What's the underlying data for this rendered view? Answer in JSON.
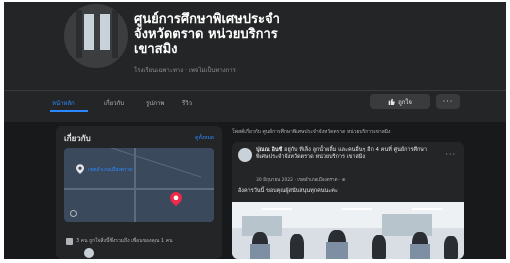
{
  "page": {
    "title_lines": [
      "ศูนย์การศึกษาพิเศษประจำ",
      "จังหวัดตราด หน่วยบริการ",
      "เขาสมิง"
    ],
    "subtitle": "โรงเรียนเฉพาะทาง · เพจไม่เป็นทางการ"
  },
  "tabs": [
    {
      "label": "หน้าหลัก",
      "active": true
    },
    {
      "label": "เกี่ยวกับ",
      "active": false
    },
    {
      "label": "รูปภาพ",
      "active": false
    },
    {
      "label": "รีวิว",
      "active": false
    }
  ],
  "actions": {
    "like_label": "ถูกใจ",
    "more_label": "···"
  },
  "about": {
    "title": "เกี่ยวกับ",
    "see_all": "ดูทั้งหมด",
    "map_label": "เขตอำเภอเมืองตราด",
    "likes_text": "3 คน ถูกใจสิ่งนี้ซึ่งรวมถึง เพื่อนของคุณ 1 คน"
  },
  "feed": {
    "header": "โพสต์เกี่ยวกับ ศูนย์การศึกษาพิเศษประจำจังหวัดตราด หน่วยบริการเขาสมิง",
    "post": {
      "author": "ปุณณ อินซี",
      "meta_rest": " อยู่กับ ทีเล็ง ลูกน้ำผลิ้ม และคนอื่นๆ อีก 4 คนที่ ศูนย์การศึกษาพิเศษประจำจังหวัดตราด หน่วยบริการ เขาสมิง",
      "time": "30 มิถุนายน 2022 · เขตอำเภอเมืองตราด · ⊕",
      "text": "อังคารวันนี้ ขอบคุณผู้สนับสนุนทุกคนนะคะ",
      "more": "···"
    }
  },
  "colors": {
    "background": "#18191a",
    "card": "#242526",
    "accent": "#2d88ff",
    "text": "#e4e6eb",
    "muted": "#b0b3b8"
  },
  "icons": [
    "thumbs-up-icon",
    "map-pin-icon",
    "map-marker-icon",
    "settings-icon",
    "likes-icon"
  ]
}
